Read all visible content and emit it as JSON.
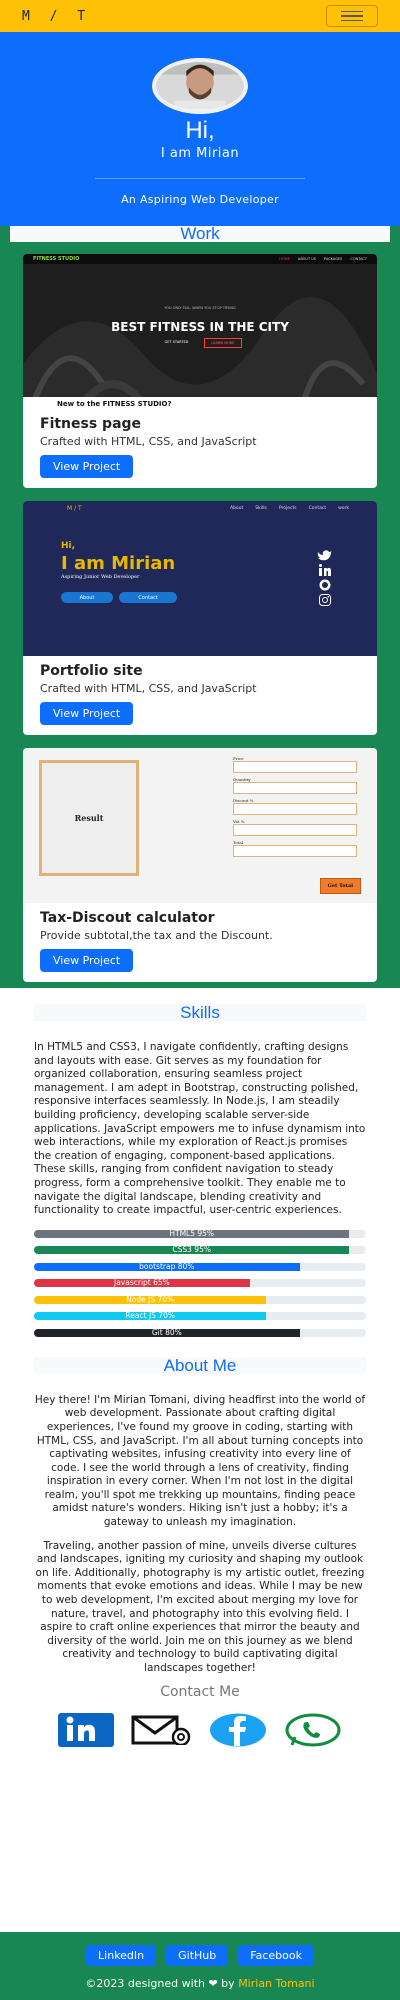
{
  "navbar": {
    "brand": "M / T",
    "toggler_icon": "hamburger-icon"
  },
  "hero": {
    "greeting": "Hi,",
    "name_line": "I am Mirian",
    "tagline": "An Aspiring Web Developer"
  },
  "work": {
    "title": "Work",
    "projects": [
      {
        "title": "Fitness page",
        "description": "Crafted with HTML, CSS, and JavaScript",
        "button": "View Project",
        "preview": {
          "logo": "FITNESS STUDIO",
          "nav": [
            "HOME",
            "ABOUT US",
            "PACKAGES",
            "CONTACT"
          ],
          "small": "YOU ONLY FAIL, WHEN YOU STOP TRYING",
          "headline": "BEST FITNESS IN THE CITY",
          "btn1": "GET STARTED",
          "btn2": "LEARN MORE",
          "caption": "New to the FITNESS STUDIO?"
        }
      },
      {
        "title": "Portfolio site",
        "description": "Crafted with HTML, CSS, and JavaScript",
        "button": "View Project",
        "preview": {
          "logo": "M / T",
          "nav": [
            "About",
            "Skills",
            "Projects",
            "Contact",
            "work"
          ],
          "hi": "Hi,",
          "name": "I am Mirian",
          "aspire": "Aspiring Junior Web Developer",
          "btn1": "About",
          "btn2": "Contact"
        }
      },
      {
        "title": "Tax-Discout calculator",
        "description": "Provide subtotal,the tax and the Discount.",
        "button": "View Project",
        "preview": {
          "result": "Result",
          "labels": [
            "Price",
            "Quantity",
            "Discout %",
            "Vat %",
            "Total"
          ],
          "get_total": "Get Total"
        }
      }
    ]
  },
  "skills": {
    "title": "Skills",
    "text": "In HTML5 and CSS3, I navigate confidently, crafting designs and layouts with ease. Git serves as my foundation for organized collaboration, ensuring seamless project management. I am adept in Bootstrap, constructing polished, responsive interfaces seamlessly. In Node.js, I am steadily building proficiency, developing scalable server-side applications. JavaScript empowers me to infuse dynamism into web interactions, while my exploration of React.js promises the creation of engaging, component-based applications. These skills, ranging from confident navigation to steady progress, form a comprehensive toolkit. They enable me to navigate the digital landscape, blending creativity and functionality to create impactful, user-centric experiences.",
    "bars": [
      {
        "label": "HTML5 95%",
        "percent": 95,
        "color": "#6c757d"
      },
      {
        "label": "CSS3 95%",
        "percent": 95,
        "color": "#198754"
      },
      {
        "label": "bootstrap 80%",
        "percent": 80,
        "color": "#0d6efd"
      },
      {
        "label": "Javascript 65%",
        "percent": 65,
        "color": "#dc3545"
      },
      {
        "label": "Node JS 70%",
        "percent": 70,
        "color": "#ffc107"
      },
      {
        "label": "React JS 70%",
        "percent": 70,
        "color": "#0dcaf0"
      },
      {
        "label": "Git 80%",
        "percent": 80,
        "color": "#212529"
      }
    ]
  },
  "about": {
    "title": "About Me",
    "paragraph1": "Hey there! I'm Mirian Tomani, diving headfirst into the world of web development. Passionate about crafting digital experiences, I've found my groove in coding, starting with HTML, CSS, and JavaScript. I'm all about turning concepts into captivating websites, infusing creativity into every line of code. I see the world through a lens of creativity, finding inspiration in every corner. When I'm not lost in the digital realm, you'll spot me trekking up mountains, finding peace amidst nature's wonders. Hiking isn't just a hobby; it's a gateway to unleash my imagination.",
    "paragraph2": "Traveling, another passion of mine, unveils diverse cultures and landscapes, igniting my curiosity and shaping my outlook on life. Additionally, photography is my artistic outlet, freezing moments that evoke emotions and ideas. While I may be new to web development, I'm excited about merging my love for nature, travel, and photography into this evolving field. I aspire to craft online experiences that mirror the beauty and diversity of the world. Join me on this journey as we blend creativity and technology to build captivating digital landscapes together!",
    "contact_title": "Contact Me",
    "social_icons": [
      "linkedin-icon",
      "mail-icon",
      "facebook-icon",
      "whatsapp-icon"
    ]
  },
  "footer": {
    "links": [
      "LinkedIn",
      "GitHub",
      "Facebook"
    ],
    "copyright": "©2023 designed with ❤ by",
    "name": "Mirian Tomani"
  },
  "colors": {
    "primary": "#0d6efd",
    "accent": "#ffc107",
    "success": "#198754"
  }
}
